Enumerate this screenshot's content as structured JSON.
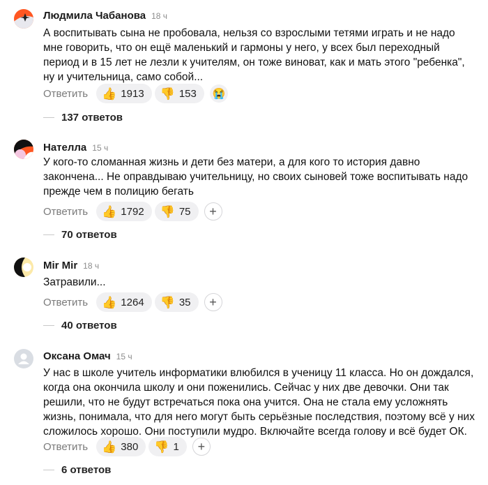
{
  "reply_label": "Ответить",
  "comments": [
    {
      "author": "Людмила Чабанова",
      "time": "18 ч",
      "text": "А воспитывать сына не пробовала, нельзя со взрослыми тетями играть и не надо мне говорить, что он ещё маленький и гармоны у него, у всех был переходный период и в 15 лет не лезли к учителям, он тоже виноват, как и мать этого \"ребенка\", ну и учительница, само собой...",
      "likes": "1913",
      "dislikes": "153",
      "extra_reaction": "😭",
      "replies": "137 ответов"
    },
    {
      "author": "Нателла",
      "time": "15 ч",
      "text": "У кого-то сломанная жизнь и дети без матери, а для кого то история давно закончена... Не оправдываю учительницу, но своих сыновей тоже воспитывать надо прежде чем в полицию бегать",
      "likes": "1792",
      "dislikes": "75",
      "extra_reaction": "+",
      "replies": "70 ответов"
    },
    {
      "author": "Mir Mir",
      "time": "18 ч",
      "text": "Затравили...",
      "likes": "1264",
      "dislikes": "35",
      "extra_reaction": "+",
      "replies": "40 ответов"
    },
    {
      "author": "Оксана Омач",
      "time": "15 ч",
      "text": "У нас в школе учитель информатики влюбился в ученицу 11 класса. Но он дождался, когда она окончила школу и они поженились. Сейчас у них две девочки. Они так решили, что не будут встречаться пока она учится. Она не стала ему усложнять жизнь, понимала, что для него могут быть серьёзные последствия, поэтому всё у них сложилось хорошо. Они поступили мудро. Включайте всегда голову и всё будет ОК.",
      "likes": "380",
      "dislikes": "1",
      "extra_reaction": "+",
      "replies": "6 ответов"
    }
  ],
  "icons": {
    "like": "thumbs-up-emoji",
    "dislike": "thumbs-down-emoji"
  },
  "colors": {
    "pill_bg": "#f0f0f2",
    "time": "#8c8c8c",
    "reply": "#7a7a7a"
  }
}
